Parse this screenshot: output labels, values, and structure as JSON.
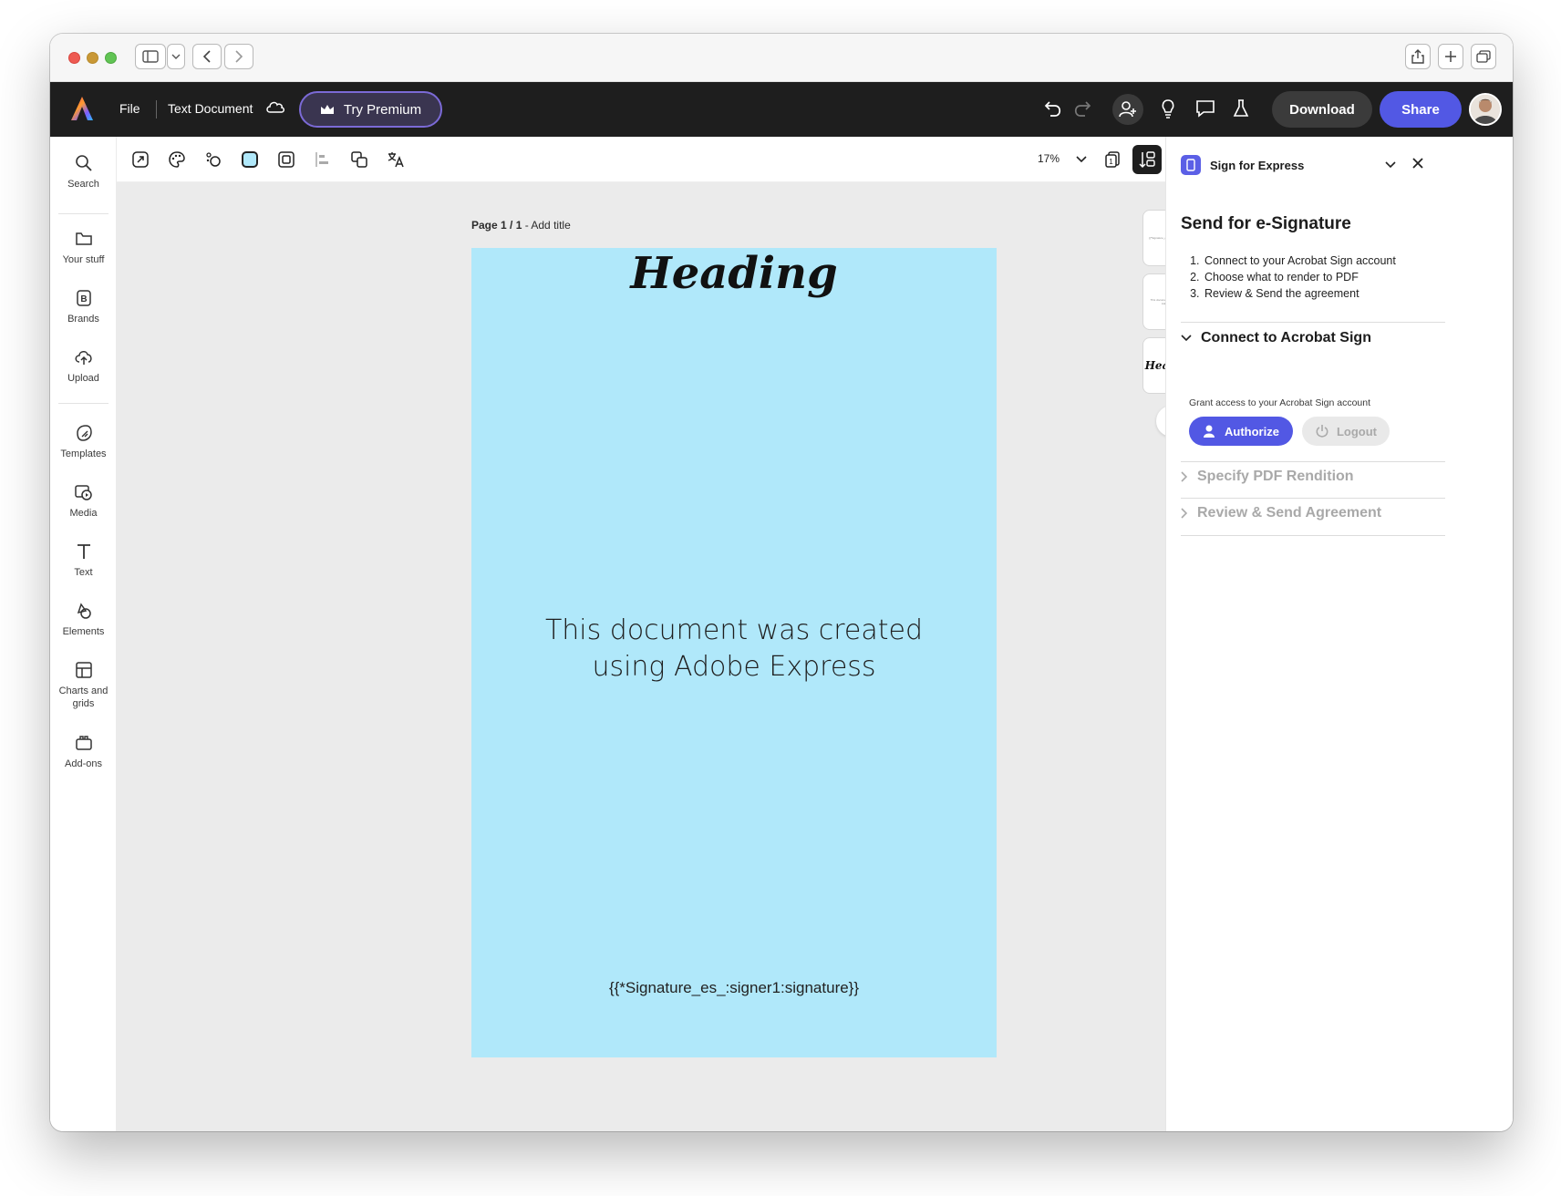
{
  "appbar": {
    "file_label": "File",
    "doc_title": "Text Document",
    "premium_label": "Try Premium",
    "download_label": "Download",
    "share_label": "Share"
  },
  "rail": {
    "items": [
      {
        "label": "Search",
        "icon": "search-icon"
      },
      {
        "label": "Your stuff",
        "icon": "folder-icon"
      },
      {
        "label": "Brands",
        "icon": "brand-icon"
      },
      {
        "label": "Upload",
        "icon": "upload-icon"
      },
      {
        "label": "Templates",
        "icon": "templates-icon"
      },
      {
        "label": "Media",
        "icon": "media-icon"
      },
      {
        "label": "Text",
        "icon": "text-icon"
      },
      {
        "label": "Elements",
        "icon": "elements-icon"
      },
      {
        "label": "Charts and grids",
        "icon": "charts-icon"
      },
      {
        "label": "Add-ons",
        "icon": "addons-icon"
      }
    ]
  },
  "toolbar": {
    "zoom": "17%"
  },
  "canvas": {
    "page_prefix": "Page 1 / 1",
    "page_title_placeholder": " - Add title",
    "doc_heading": "Heading",
    "doc_body_line1": "This document was created",
    "doc_body_line2": "using Adobe Express",
    "doc_signature": "{{*Signature_es_:signer1:signature}}",
    "doc_background": "#b0e8fa",
    "thumb_heading": "Heading",
    "thumb1_text": "{{*Signature_es_:signer1:signature}}",
    "thumb2_text": "This document was created using Adobe Express"
  },
  "panel": {
    "title": "Sign for Express",
    "heading": "Send for e-Signature",
    "steps": [
      "Connect to your Acrobat Sign account",
      "Choose what to render to PDF",
      "Review & Send the agreement"
    ],
    "connect_section": "Connect to Acrobat Sign",
    "grant_text": "Grant access to your Acrobat Sign account",
    "authorize_label": "Authorize",
    "logout_label": "Logout",
    "pdf_section": "Specify PDF Rendition",
    "review_section": "Review & Send Agreement"
  },
  "colors": {
    "accent": "#5258e4",
    "appbar_bg": "#1e1e1e",
    "canvas_bg": "#ebebeb"
  }
}
